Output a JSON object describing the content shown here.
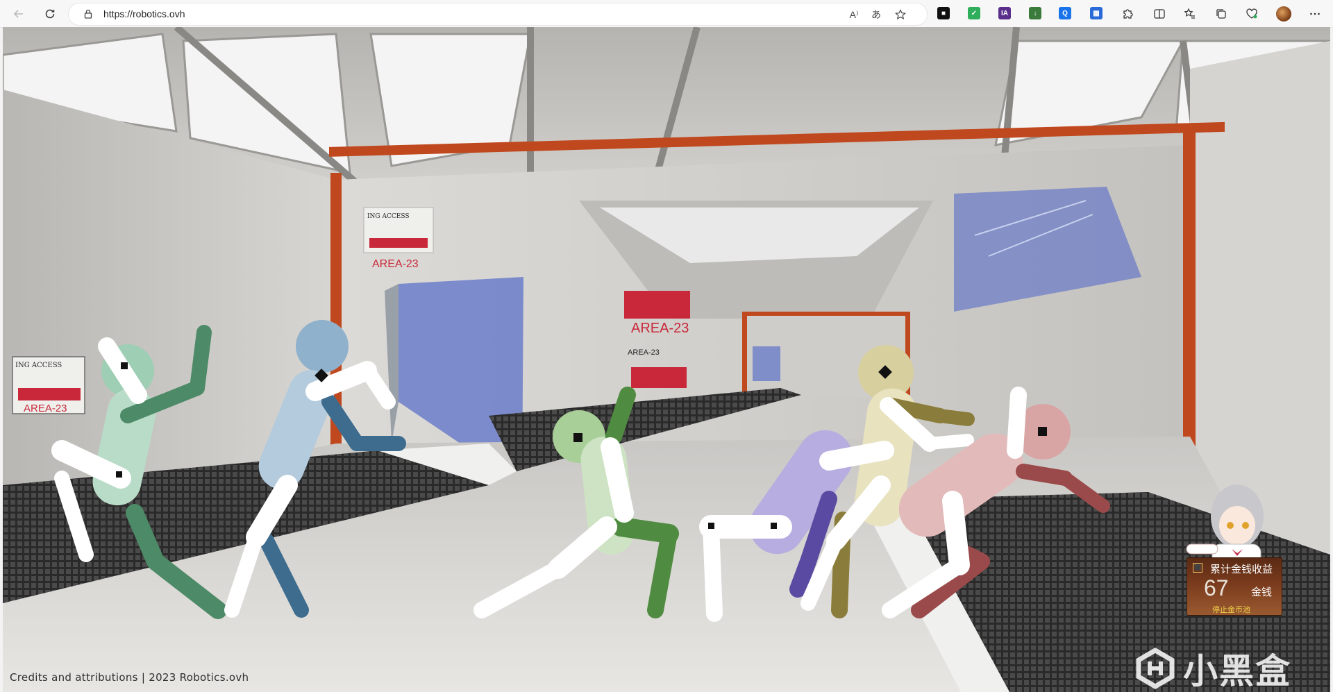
{
  "browser": {
    "url": "https://robotics.ovh",
    "back_icon": "arrow-left-icon",
    "refresh_icon": "refresh-icon",
    "read_aloud_glyph": "A⁾",
    "translate_glyph": "あ",
    "favorite_icon": "star-icon",
    "extensions": [
      {
        "name": "ext-cube",
        "glyph": "■",
        "color": "#111111"
      },
      {
        "name": "ext-shield",
        "glyph": "✓",
        "color": "#2fae5c"
      },
      {
        "name": "ext-ia",
        "glyph": "IA",
        "color": "#5a2f8c"
      },
      {
        "name": "ext-download",
        "glyph": "↓",
        "color": "#3a7a3a"
      },
      {
        "name": "ext-search",
        "glyph": "Q",
        "color": "#1a73e8"
      },
      {
        "name": "ext-grid",
        "glyph": "▦",
        "color": "#2a6ad8"
      }
    ]
  },
  "scene": {
    "sign_text": "AREA-23",
    "sign_caption": "ING ACCESS",
    "sign_small": "AREA-23"
  },
  "footer": {
    "credits": "Credits and attributions | 2023 Robotics.ovh"
  },
  "widget": {
    "badge": "⬛",
    "title": "累计金钱收益",
    "amount": "67",
    "unit": "金钱",
    "stop": "停止金币池"
  },
  "watermark": {
    "text": "小黑盒"
  },
  "colors": {
    "accent_orange": "#c0481e",
    "window_blue": "#4a63c8"
  }
}
